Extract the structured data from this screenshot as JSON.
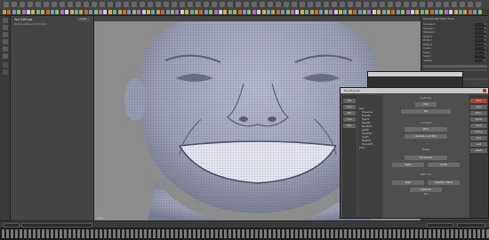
{
  "tool_settings": {
    "title": "Tool Settings",
    "reset_label": "Reset",
    "info": "No tool settings for this tool"
  },
  "viewport": {
    "camera_label": "persp"
  },
  "channel_box": {
    "header": "Channels  Edit  Object  Show",
    "rows": [
      {
        "label": "Translate X",
        "value": "0"
      },
      {
        "label": "Translate Y",
        "value": "0"
      },
      {
        "label": "Translate Z",
        "value": "0"
      },
      {
        "label": "Rotate X",
        "value": "0"
      },
      {
        "label": "Rotate Y",
        "value": "0"
      },
      {
        "label": "Rotate Z",
        "value": "0"
      },
      {
        "label": "Scale X",
        "value": "1"
      },
      {
        "label": "Scale Y",
        "value": "1"
      },
      {
        "label": "Scale Z",
        "value": "1"
      },
      {
        "label": "Visibility",
        "value": "on"
      }
    ]
  },
  "plugin_window": {
    "title": "Face Rig Tool",
    "left_buttons": [
      "Face",
      "Body",
      "Edit",
      "Tools",
      "Help"
    ],
    "tree_items": [
      "Root",
      "FaceGroup",
      "BrowCtrl",
      "EyeCtrl",
      "NoseCtrl",
      "MouthCtrl",
      "JawCtrl",
      "CheekCtrl",
      "LipCtrl",
      "TeethCtrl",
      "TongueCtrl",
      "Head"
    ],
    "sections": [
      "Create Rig",
      "Controllers",
      "Shapes",
      "Deformers",
      "Skin"
    ],
    "center_buttons": [
      "Build",
      "Add",
      "Mirror",
      "Duplicate + Link Face",
      "Link Selected",
      "Select",
      "Update",
      "Apply",
      "Duplicate + Mirror",
      "Create Set"
    ],
    "right_buttons": [
      "Build",
      "Reset",
      "Mirror",
      "Export",
      "Import",
      "Options",
      "Save",
      "Load",
      "Delete"
    ]
  }
}
